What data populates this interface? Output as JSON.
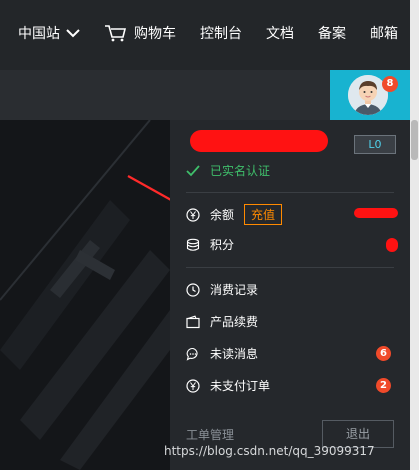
{
  "topnav": {
    "items": [
      {
        "label": "中国站"
      },
      {
        "label": "购物车"
      },
      {
        "label": "控制台"
      },
      {
        "label": "文档"
      },
      {
        "label": "备案"
      },
      {
        "label": "邮箱"
      }
    ]
  },
  "account": {
    "avatar_badge": "8",
    "level": "L0",
    "verified": "已实名认证"
  },
  "finance": {
    "balance_label": "余额",
    "recharge_label": "充值",
    "points_label": "积分"
  },
  "menu": [
    {
      "label": "消费记录",
      "icon": "clock-icon"
    },
    {
      "label": "产品续费",
      "icon": "wallet-icon"
    },
    {
      "label": "未读消息",
      "icon": "message-icon",
      "badge": "6"
    },
    {
      "label": "未支付订单",
      "icon": "yen-icon",
      "badge": "2"
    }
  ],
  "footer": {
    "ticket_label": "工单管理",
    "logout_label": "退出"
  },
  "watermark": "https://blog.csdn.net/qq_39099317",
  "colors": {
    "accent": "#18b3d0",
    "badge": "#f04a2a",
    "recharge": "#ff8a00",
    "verified": "#3fbf6b",
    "redact": "#ff1212"
  }
}
